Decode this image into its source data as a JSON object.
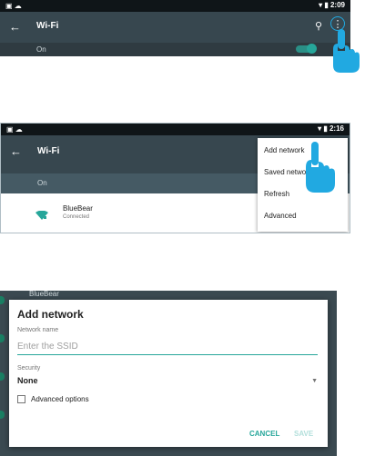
{
  "panel1": {
    "status_time": "2:09",
    "title": "Wi-Fi",
    "on_label": "On"
  },
  "panel2": {
    "status_time": "2:16",
    "title": "Wi-Fi",
    "on_label": "On",
    "network": {
      "name": "BlueBear",
      "status": "Connected"
    },
    "menu_items": [
      "Add network",
      "Saved network",
      "Refresh",
      "Advanced"
    ]
  },
  "panel3": {
    "background_network": "BlueBear",
    "dialog": {
      "title": "Add network",
      "network_name_label": "Network name",
      "ssid_placeholder": "Enter the SSID",
      "security_label": "Security",
      "security_value": "None",
      "advanced_label": "Advanced options",
      "cancel_label": "CANCEL",
      "save_label": "SAVE"
    }
  },
  "colors": {
    "accent": "#26a69a",
    "toolbar": "#37474f",
    "hand": "#21a9e1"
  }
}
